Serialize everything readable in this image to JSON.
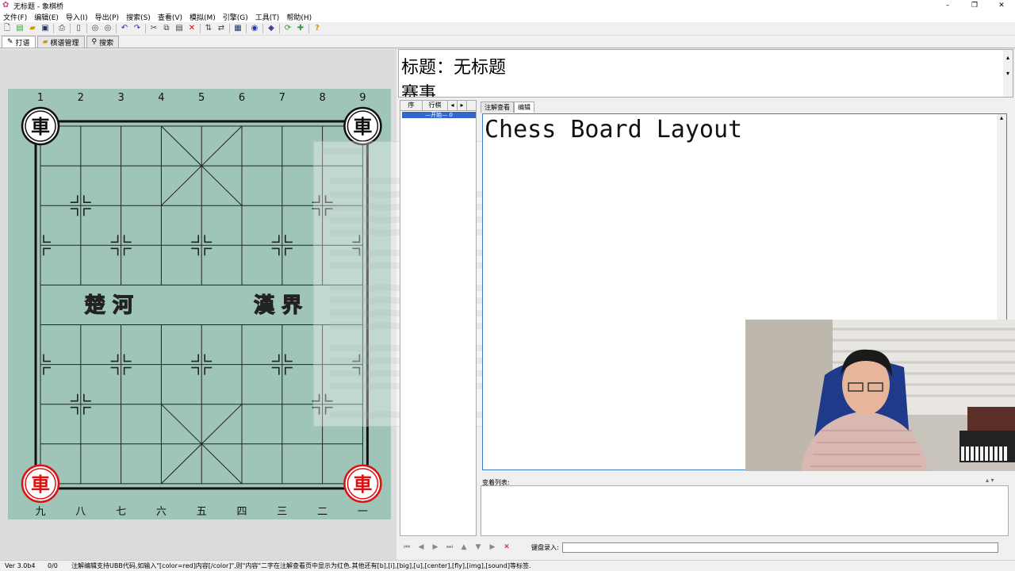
{
  "window": {
    "title": "无标题 - 象棋桥",
    "minimize": "–",
    "maximize": "❐",
    "close": "✕"
  },
  "menu": [
    "文件(F)",
    "编辑(E)",
    "导入(I)",
    "导出(P)",
    "搜索(S)",
    "查看(V)",
    "模拟(M)",
    "引擎(G)",
    "工具(T)",
    "帮助(H)"
  ],
  "toolbar_icons": [
    "new-icon",
    "open-icon",
    "folder-icon",
    "save-icon",
    "print-icon",
    "trash-icon",
    "back-icon",
    "forward-icon",
    "undo-icon",
    "redo-icon",
    "cut-icon",
    "copy-icon",
    "paste-icon",
    "delete-icon",
    "flip-vertical-icon",
    "flip-horizontal-icon",
    "board-icon",
    "engine-icon",
    "tag-icon",
    "refresh-icon",
    "puzzle-icon",
    "help-icon"
  ],
  "tabs": [
    {
      "label": "打谱",
      "icon": "pencil-icon",
      "active": true
    },
    {
      "label": "棋谱管理",
      "icon": "folder-icon",
      "active": false
    },
    {
      "label": "搜索",
      "icon": "search-icon",
      "active": false
    }
  ],
  "board": {
    "top_files": [
      "1",
      "2",
      "3",
      "4",
      "5",
      "6",
      "7",
      "8",
      "9"
    ],
    "bottom_files": [
      "九",
      "八",
      "七",
      "六",
      "五",
      "四",
      "三",
      "二",
      "一"
    ],
    "river_left": "楚  河",
    "river_right": "漢  界",
    "pieces": [
      {
        "char": "車",
        "side": "black",
        "file": 0,
        "rank": 0
      },
      {
        "char": "車",
        "side": "black",
        "file": 8,
        "rank": 0
      },
      {
        "char": "車",
        "side": "red",
        "file": 0,
        "rank": 9
      },
      {
        "char": "車",
        "side": "red",
        "file": 8,
        "rank": 9
      }
    ]
  },
  "header": {
    "title": "标题：无标题",
    "line2": "赛事."
  },
  "movelist": {
    "col_index": "序",
    "col_move": "行棋",
    "col_nav1": "◂",
    "col_nav2": "▸",
    "first_row": "—开始— 0"
  },
  "comment_tabs": [
    {
      "label": "注解查看",
      "active": false
    },
    {
      "label": "编辑",
      "active": true
    }
  ],
  "editor_text": "Chess Board Layout",
  "variation_label": "变着列表:",
  "variation_arrows": "▴ ▾",
  "nav_buttons": [
    "⏮",
    "◀",
    "▶",
    "⏭",
    "▲",
    "▼",
    "▶",
    "✕"
  ],
  "board_input_label": "键盘录入:",
  "status": {
    "version": "Ver 3.0b4",
    "count": "0/0",
    "message": "注解编辑支持UBB代码,如输入\"[color=red]内容[/color]\",则\"内容\"二字在注解查看页中显示为红色.其他还有[b],[i],[big],[u],[center],[fly],[img],[sound]等标签."
  }
}
